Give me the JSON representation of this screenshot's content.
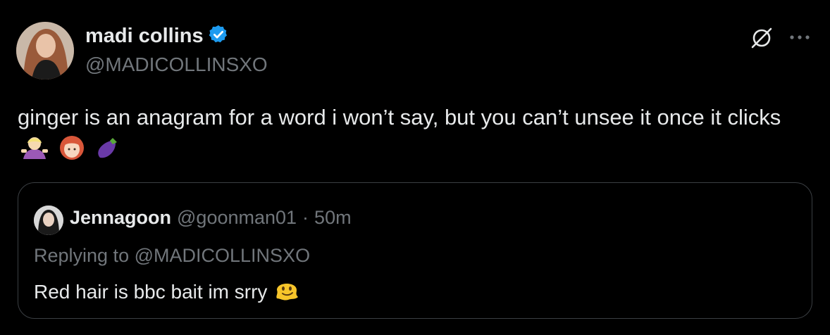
{
  "author": {
    "display_name": "madi collins",
    "handle": "@MADICOLLINSXO",
    "verified": true,
    "verified_color": "#1d9bf0"
  },
  "tweet": {
    "text": "ginger is an anagram for a word i won’t say, but you can’t unsee it once it clicks",
    "emojis": [
      "person-shrugging-emoji",
      "red-haired-woman-emoji",
      "eggplant-emoji"
    ]
  },
  "quoted": {
    "display_name": "Jennagoon",
    "handle": "@goonman01",
    "separator": "·",
    "time": "50m",
    "replying_prefix": "Replying to",
    "replying_handle": "@MADICOLLINSXO",
    "text": "Red hair is bbc bait im srry",
    "emoji": "melting-face-emoji"
  },
  "icons": [
    "grok-icon",
    "more-icon"
  ]
}
